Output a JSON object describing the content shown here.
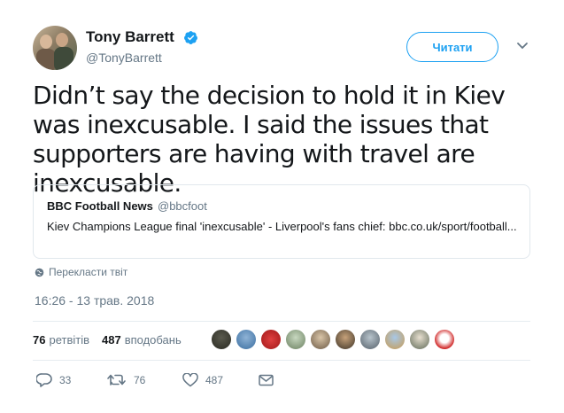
{
  "author": {
    "name": "Tony Barrett",
    "handle": "@TonyBarrett",
    "verified_icon": "verified-badge-icon"
  },
  "follow_button": {
    "label": "Читати"
  },
  "tweet": {
    "text": "Didn’t say the decision to hold it in Kiev was inexcusable. I said the issues that supporters are having with travel are inexcusable."
  },
  "quoted_tweet": {
    "name": "BBC Football News",
    "handle": "@bbcfoot",
    "text": "Kiev Champions League final 'inexcusable' - Liverpool's fans chief: bbc.co.uk/sport/football..."
  },
  "translate": {
    "label": "Перекласти твіт",
    "icon": "globe-icon"
  },
  "timestamp": "16:26 - 13 трав. 2018",
  "stats": {
    "retweets_count": "76",
    "retweets_label": "ретвітів",
    "likes_count": "487",
    "likes_label": "вподобань"
  },
  "likers": [
    "liker-1",
    "liker-2",
    "liker-3",
    "liker-4",
    "liker-5",
    "liker-6",
    "liker-7",
    "liker-8",
    "liker-9",
    "liker-10"
  ],
  "actions": {
    "replies": "33",
    "retweets": "76",
    "likes": "487"
  },
  "colors": {
    "accent": "#1da1f2",
    "text": "#14171a",
    "muted": "#657786",
    "border": "#e1e8ed"
  }
}
